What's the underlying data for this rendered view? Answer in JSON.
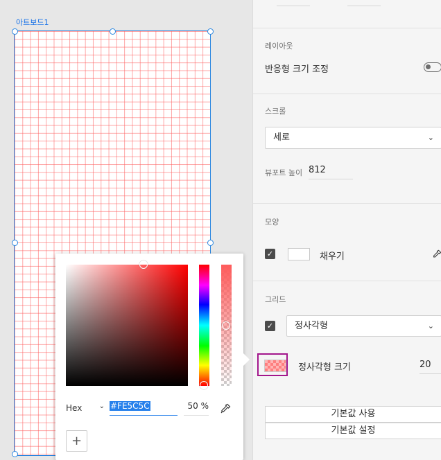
{
  "canvas": {
    "artboard_name": "아트보드1"
  },
  "panel": {
    "layout": {
      "title": "레이아웃",
      "responsive_label": "반응형 크기 조정",
      "responsive_on": false
    },
    "scroll": {
      "title": "스크롤",
      "value": "세로",
      "viewport_label": "뷰포트 높이",
      "viewport_value": "812"
    },
    "appearance": {
      "title": "모양",
      "fill_label": "채우기",
      "fill_checked": true,
      "fill_color": "#FFFFFF"
    },
    "grid": {
      "title": "그리드",
      "enabled": true,
      "type": "정사각형",
      "size_label": "정사각형 크기",
      "size_value": "20",
      "color": "#FE5C5C",
      "use_default": "기본값 사용",
      "set_default": "기본값 설정"
    }
  },
  "color_picker": {
    "mode": "Hex",
    "hex": "#FE5C5C",
    "opacity": "50 %",
    "add_label": "+"
  },
  "icons": {
    "chevron": "chevron-down-icon",
    "check": "checkmark-icon",
    "eyedropper": "eyedropper-icon"
  }
}
